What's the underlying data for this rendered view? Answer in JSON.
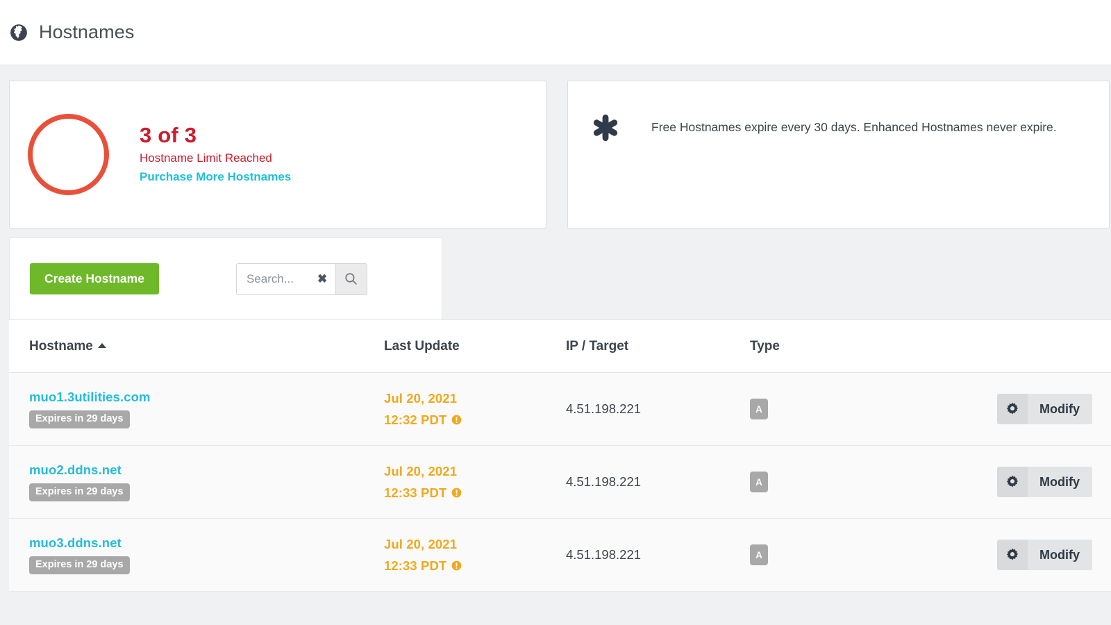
{
  "header": {
    "title": "Hostnames",
    "icon": "globe-icon"
  },
  "limit_card": {
    "count": "3 of 3",
    "status": "Hostname Limit Reached",
    "link": "Purchase More Hostnames",
    "ring_color": "#e8503a",
    "text_color": "#cc1c2b",
    "link_color": "#1ec1d8"
  },
  "note_card": {
    "icon": "asterisk-icon",
    "text": "Free Hostnames expire every 30 days. Enhanced Hostnames never expire."
  },
  "toolbar": {
    "create_label": "Create Hostname",
    "create_color": "#6eb829",
    "search_placeholder": "Search...",
    "search_value": "",
    "clear_icon": "✖",
    "search_icon": "search-icon"
  },
  "table": {
    "columns": [
      {
        "label": "Hostname",
        "sorted": true,
        "sort_dir": "asc"
      },
      {
        "label": "Last Update",
        "sorted": false
      },
      {
        "label": "IP / Target",
        "sorted": false
      },
      {
        "label": "Type",
        "sorted": false
      }
    ],
    "rows": [
      {
        "hostname": "muo1.3utilities.com",
        "expires": "Expires in 29 days",
        "update_date": "Jul 20, 2021",
        "update_time": "12:32 PDT",
        "ip": "4.51.198.221",
        "type": "A",
        "modify_label": "Modify",
        "delete_icon": "✖"
      },
      {
        "hostname": "muo2.ddns.net",
        "expires": "Expires in 29 days",
        "update_date": "Jul 20, 2021",
        "update_time": "12:33 PDT",
        "ip": "4.51.198.221",
        "type": "A",
        "modify_label": "Modify",
        "delete_icon": "✖"
      },
      {
        "hostname": "muo3.ddns.net",
        "expires": "Expires in 29 days",
        "update_date": "Jul 20, 2021",
        "update_time": "12:33 PDT",
        "ip": "4.51.198.221",
        "type": "A",
        "modify_label": "Modify",
        "delete_icon": "✖"
      }
    ]
  },
  "colors": {
    "link_teal": "#25bcd8",
    "warning_orange": "#f0a91e",
    "badge_gray": "#a8a8a8",
    "page_bg": "#f0f1f2"
  }
}
